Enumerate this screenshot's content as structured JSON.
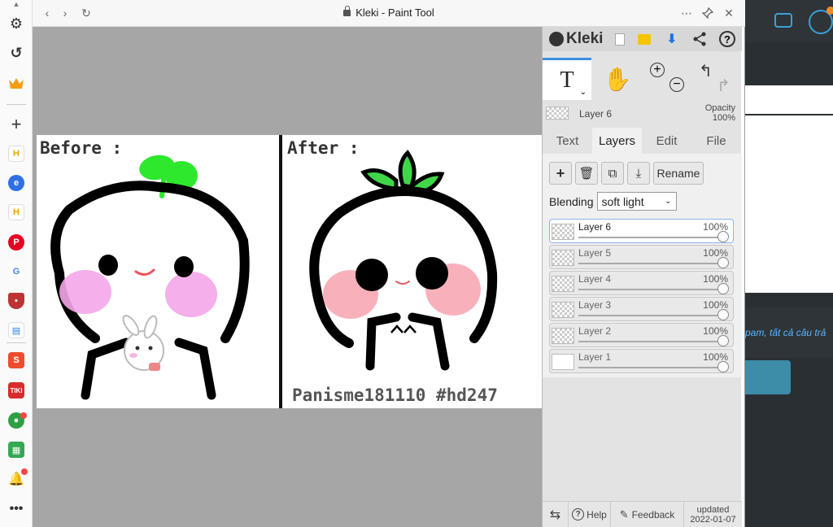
{
  "window": {
    "title": "Kleki - Paint Tool"
  },
  "canvas": {
    "before_label": "Before :",
    "after_label": "After :",
    "watermark": "Panisme181110 #hd247"
  },
  "panel": {
    "logo": "Kleki",
    "current_layer": "Layer 6",
    "opacity_label": "Opacity",
    "opacity_value": "100%",
    "tabs": [
      "Text",
      "Layers",
      "Edit",
      "File"
    ],
    "rename_label": "Rename",
    "blending_label": "Blending",
    "blending_value": "soft light",
    "layers": [
      {
        "name": "Layer 6",
        "opacity": "100%"
      },
      {
        "name": "Layer 5",
        "opacity": "100%"
      },
      {
        "name": "Layer 4",
        "opacity": "100%"
      },
      {
        "name": "Layer 3",
        "opacity": "100%"
      },
      {
        "name": "Layer 2",
        "opacity": "100%"
      },
      {
        "name": "Layer 1",
        "opacity": "100%"
      }
    ],
    "footer": {
      "help": "Help",
      "feedback": "Feedback",
      "updated_label": "updated",
      "updated_date": "2022-01-07"
    }
  },
  "right_app": {
    "snippet": "pam, tất cả câu trả"
  },
  "colors": {
    "accent": "#3a8ee6",
    "download": "#1a73e8",
    "canvas_bg": "#a6a6a6",
    "sprout": "#2ee82e"
  }
}
